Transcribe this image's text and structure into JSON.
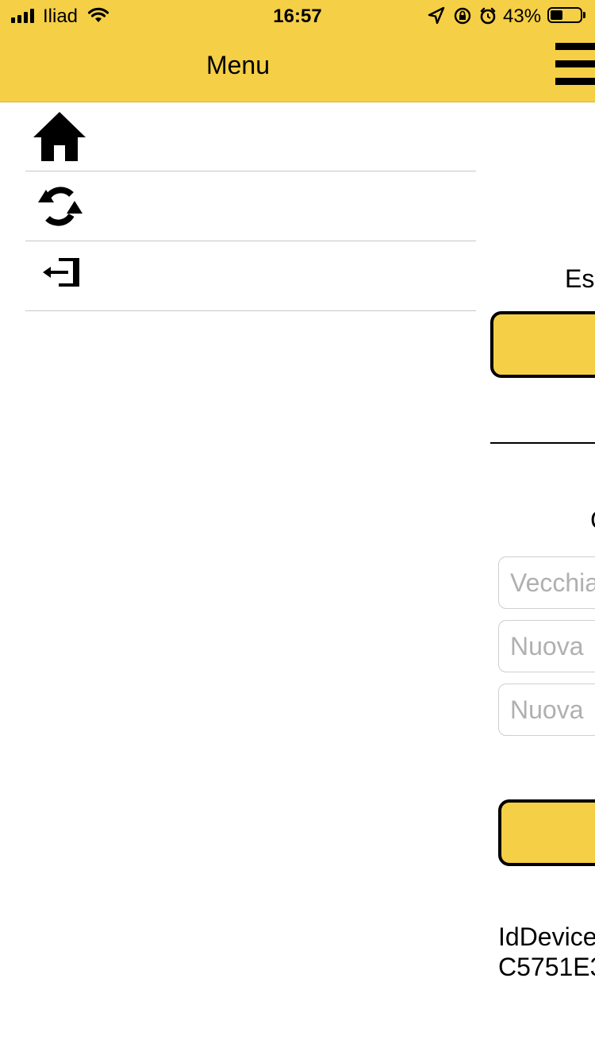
{
  "status_bar": {
    "carrier": "Iliad",
    "time": "16:57",
    "battery_percent": "43%",
    "battery_level": 0.43,
    "icons": [
      "signal-icon",
      "wifi-icon",
      "location-icon",
      "rotation-lock-icon",
      "alarm-icon",
      "battery-icon"
    ]
  },
  "header": {
    "title": "Menu",
    "menu_icon": "hamburger-icon"
  },
  "menu": {
    "items": [
      {
        "icon": "home-icon",
        "label": ""
      },
      {
        "icon": "sync-icon",
        "label": ""
      },
      {
        "icon": "logout-icon",
        "label": ""
      }
    ]
  },
  "content": {
    "label_partial": "Es",
    "section_title_partial": "C",
    "fields": [
      {
        "placeholder": "Vecchia"
      },
      {
        "placeholder": "Nuova"
      },
      {
        "placeholder": "Nuova"
      }
    ],
    "device_label": "IdDevice",
    "device_value": "C5751E3"
  },
  "colors": {
    "accent": "#f5cf46",
    "text": "#000000",
    "divider": "#c8c8c8",
    "placeholder": "#b0b0b0"
  }
}
